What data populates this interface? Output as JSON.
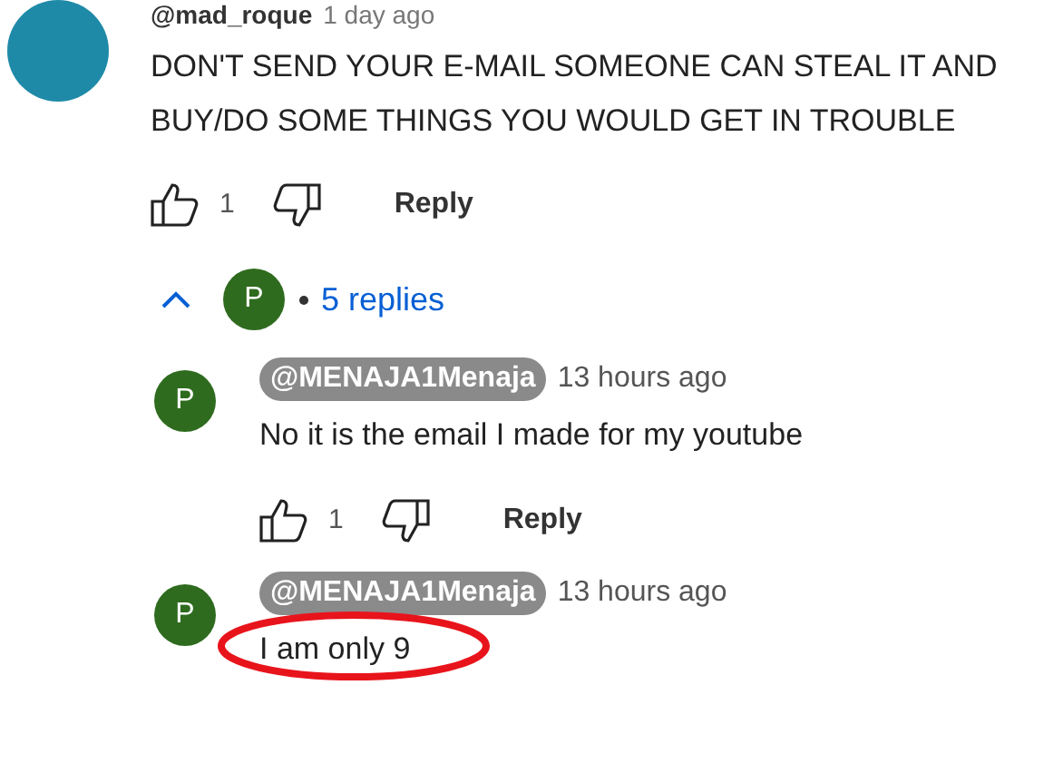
{
  "comment": {
    "author": "@mad_roque",
    "time": "1 day ago",
    "text": "DON'T SEND YOUR E-MAIL SOMEONE CAN STEAL IT AND BUY/DO SOME THINGS YOU WOULD GET IN TROUBLE",
    "likes": "1",
    "reply_label": "Reply"
  },
  "replies_toggle": {
    "expanded": true,
    "avatar_letter": "P",
    "label": "5 replies"
  },
  "replies": [
    {
      "avatar_letter": "P",
      "author": "@MENAJA1Menaja",
      "time": "13 hours ago",
      "text": "No it is the email I made for my youtube",
      "likes": "1",
      "reply_label": "Reply",
      "circled": false
    },
    {
      "avatar_letter": "P",
      "author": "@MENAJA1Menaja",
      "time": "13 hours ago",
      "text": "I am only 9",
      "circled": true
    }
  ]
}
